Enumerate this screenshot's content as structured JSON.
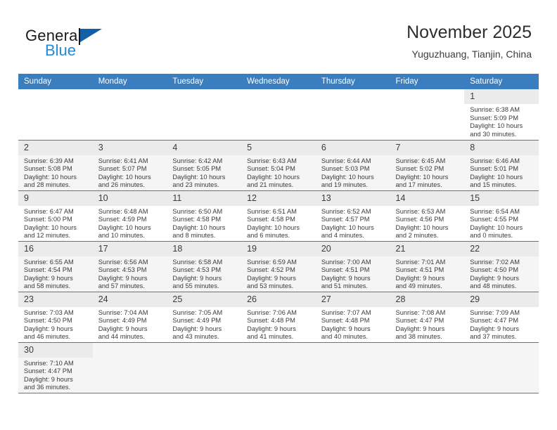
{
  "brand": {
    "name_part1": "General",
    "name_part2": "Blue",
    "flag_icon": "flag-triangle-icon",
    "colors": {
      "blue": "#2389d6",
      "flag": "#1360a8",
      "dark": "#1a1a1a"
    }
  },
  "header": {
    "title": "November 2025",
    "subtitle": "Yuguzhuang, Tianjin, China"
  },
  "calendar": {
    "header_bg": "#3a7ebf",
    "weekdays": [
      "Sunday",
      "Monday",
      "Tuesday",
      "Wednesday",
      "Thursday",
      "Friday",
      "Saturday"
    ],
    "weeks": [
      [
        {
          "day": "",
          "sunrise": "",
          "sunset": "",
          "daylight1": "",
          "daylight2": "",
          "empty": true
        },
        {
          "day": "",
          "sunrise": "",
          "sunset": "",
          "daylight1": "",
          "daylight2": "",
          "empty": true
        },
        {
          "day": "",
          "sunrise": "",
          "sunset": "",
          "daylight1": "",
          "daylight2": "",
          "empty": true
        },
        {
          "day": "",
          "sunrise": "",
          "sunset": "",
          "daylight1": "",
          "daylight2": "",
          "empty": true
        },
        {
          "day": "",
          "sunrise": "",
          "sunset": "",
          "daylight1": "",
          "daylight2": "",
          "empty": true
        },
        {
          "day": "",
          "sunrise": "",
          "sunset": "",
          "daylight1": "",
          "daylight2": "",
          "empty": true
        },
        {
          "day": "1",
          "sunrise": "Sunrise: 6:38 AM",
          "sunset": "Sunset: 5:09 PM",
          "daylight1": "Daylight: 10 hours",
          "daylight2": "and 30 minutes.",
          "empty": false
        }
      ],
      [
        {
          "day": "2",
          "sunrise": "Sunrise: 6:39 AM",
          "sunset": "Sunset: 5:08 PM",
          "daylight1": "Daylight: 10 hours",
          "daylight2": "and 28 minutes.",
          "empty": false
        },
        {
          "day": "3",
          "sunrise": "Sunrise: 6:41 AM",
          "sunset": "Sunset: 5:07 PM",
          "daylight1": "Daylight: 10 hours",
          "daylight2": "and 26 minutes.",
          "empty": false
        },
        {
          "day": "4",
          "sunrise": "Sunrise: 6:42 AM",
          "sunset": "Sunset: 5:05 PM",
          "daylight1": "Daylight: 10 hours",
          "daylight2": "and 23 minutes.",
          "empty": false
        },
        {
          "day": "5",
          "sunrise": "Sunrise: 6:43 AM",
          "sunset": "Sunset: 5:04 PM",
          "daylight1": "Daylight: 10 hours",
          "daylight2": "and 21 minutes.",
          "empty": false
        },
        {
          "day": "6",
          "sunrise": "Sunrise: 6:44 AM",
          "sunset": "Sunset: 5:03 PM",
          "daylight1": "Daylight: 10 hours",
          "daylight2": "and 19 minutes.",
          "empty": false
        },
        {
          "day": "7",
          "sunrise": "Sunrise: 6:45 AM",
          "sunset": "Sunset: 5:02 PM",
          "daylight1": "Daylight: 10 hours",
          "daylight2": "and 17 minutes.",
          "empty": false
        },
        {
          "day": "8",
          "sunrise": "Sunrise: 6:46 AM",
          "sunset": "Sunset: 5:01 PM",
          "daylight1": "Daylight: 10 hours",
          "daylight2": "and 15 minutes.",
          "empty": false
        }
      ],
      [
        {
          "day": "9",
          "sunrise": "Sunrise: 6:47 AM",
          "sunset": "Sunset: 5:00 PM",
          "daylight1": "Daylight: 10 hours",
          "daylight2": "and 12 minutes.",
          "empty": false
        },
        {
          "day": "10",
          "sunrise": "Sunrise: 6:48 AM",
          "sunset": "Sunset: 4:59 PM",
          "daylight1": "Daylight: 10 hours",
          "daylight2": "and 10 minutes.",
          "empty": false
        },
        {
          "day": "11",
          "sunrise": "Sunrise: 6:50 AM",
          "sunset": "Sunset: 4:58 PM",
          "daylight1": "Daylight: 10 hours",
          "daylight2": "and 8 minutes.",
          "empty": false
        },
        {
          "day": "12",
          "sunrise": "Sunrise: 6:51 AM",
          "sunset": "Sunset: 4:58 PM",
          "daylight1": "Daylight: 10 hours",
          "daylight2": "and 6 minutes.",
          "empty": false
        },
        {
          "day": "13",
          "sunrise": "Sunrise: 6:52 AM",
          "sunset": "Sunset: 4:57 PM",
          "daylight1": "Daylight: 10 hours",
          "daylight2": "and 4 minutes.",
          "empty": false
        },
        {
          "day": "14",
          "sunrise": "Sunrise: 6:53 AM",
          "sunset": "Sunset: 4:56 PM",
          "daylight1": "Daylight: 10 hours",
          "daylight2": "and 2 minutes.",
          "empty": false
        },
        {
          "day": "15",
          "sunrise": "Sunrise: 6:54 AM",
          "sunset": "Sunset: 4:55 PM",
          "daylight1": "Daylight: 10 hours",
          "daylight2": "and 0 minutes.",
          "empty": false
        }
      ],
      [
        {
          "day": "16",
          "sunrise": "Sunrise: 6:55 AM",
          "sunset": "Sunset: 4:54 PM",
          "daylight1": "Daylight: 9 hours",
          "daylight2": "and 58 minutes.",
          "empty": false
        },
        {
          "day": "17",
          "sunrise": "Sunrise: 6:56 AM",
          "sunset": "Sunset: 4:53 PM",
          "daylight1": "Daylight: 9 hours",
          "daylight2": "and 57 minutes.",
          "empty": false
        },
        {
          "day": "18",
          "sunrise": "Sunrise: 6:58 AM",
          "sunset": "Sunset: 4:53 PM",
          "daylight1": "Daylight: 9 hours",
          "daylight2": "and 55 minutes.",
          "empty": false
        },
        {
          "day": "19",
          "sunrise": "Sunrise: 6:59 AM",
          "sunset": "Sunset: 4:52 PM",
          "daylight1": "Daylight: 9 hours",
          "daylight2": "and 53 minutes.",
          "empty": false
        },
        {
          "day": "20",
          "sunrise": "Sunrise: 7:00 AM",
          "sunset": "Sunset: 4:51 PM",
          "daylight1": "Daylight: 9 hours",
          "daylight2": "and 51 minutes.",
          "empty": false
        },
        {
          "day": "21",
          "sunrise": "Sunrise: 7:01 AM",
          "sunset": "Sunset: 4:51 PM",
          "daylight1": "Daylight: 9 hours",
          "daylight2": "and 49 minutes.",
          "empty": false
        },
        {
          "day": "22",
          "sunrise": "Sunrise: 7:02 AM",
          "sunset": "Sunset: 4:50 PM",
          "daylight1": "Daylight: 9 hours",
          "daylight2": "and 48 minutes.",
          "empty": false
        }
      ],
      [
        {
          "day": "23",
          "sunrise": "Sunrise: 7:03 AM",
          "sunset": "Sunset: 4:50 PM",
          "daylight1": "Daylight: 9 hours",
          "daylight2": "and 46 minutes.",
          "empty": false
        },
        {
          "day": "24",
          "sunrise": "Sunrise: 7:04 AM",
          "sunset": "Sunset: 4:49 PM",
          "daylight1": "Daylight: 9 hours",
          "daylight2": "and 44 minutes.",
          "empty": false
        },
        {
          "day": "25",
          "sunrise": "Sunrise: 7:05 AM",
          "sunset": "Sunset: 4:49 PM",
          "daylight1": "Daylight: 9 hours",
          "daylight2": "and 43 minutes.",
          "empty": false
        },
        {
          "day": "26",
          "sunrise": "Sunrise: 7:06 AM",
          "sunset": "Sunset: 4:48 PM",
          "daylight1": "Daylight: 9 hours",
          "daylight2": "and 41 minutes.",
          "empty": false
        },
        {
          "day": "27",
          "sunrise": "Sunrise: 7:07 AM",
          "sunset": "Sunset: 4:48 PM",
          "daylight1": "Daylight: 9 hours",
          "daylight2": "and 40 minutes.",
          "empty": false
        },
        {
          "day": "28",
          "sunrise": "Sunrise: 7:08 AM",
          "sunset": "Sunset: 4:47 PM",
          "daylight1": "Daylight: 9 hours",
          "daylight2": "and 38 minutes.",
          "empty": false
        },
        {
          "day": "29",
          "sunrise": "Sunrise: 7:09 AM",
          "sunset": "Sunset: 4:47 PM",
          "daylight1": "Daylight: 9 hours",
          "daylight2": "and 37 minutes.",
          "empty": false
        }
      ],
      [
        {
          "day": "30",
          "sunrise": "Sunrise: 7:10 AM",
          "sunset": "Sunset: 4:47 PM",
          "daylight1": "Daylight: 9 hours",
          "daylight2": "and 36 minutes.",
          "empty": false
        },
        {
          "day": "",
          "sunrise": "",
          "sunset": "",
          "daylight1": "",
          "daylight2": "",
          "empty": true
        },
        {
          "day": "",
          "sunrise": "",
          "sunset": "",
          "daylight1": "",
          "daylight2": "",
          "empty": true
        },
        {
          "day": "",
          "sunrise": "",
          "sunset": "",
          "daylight1": "",
          "daylight2": "",
          "empty": true
        },
        {
          "day": "",
          "sunrise": "",
          "sunset": "",
          "daylight1": "",
          "daylight2": "",
          "empty": true
        },
        {
          "day": "",
          "sunrise": "",
          "sunset": "",
          "daylight1": "",
          "daylight2": "",
          "empty": true
        },
        {
          "day": "",
          "sunrise": "",
          "sunset": "",
          "daylight1": "",
          "daylight2": "",
          "empty": true
        }
      ]
    ]
  }
}
